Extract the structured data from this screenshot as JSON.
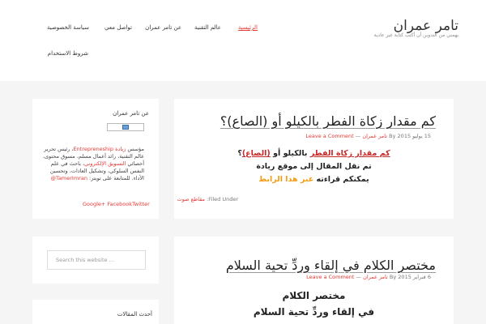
{
  "header": {
    "site_title": "تامر عمران",
    "site_description": "يهمني من التدوين أن أكتب كتابة غير عادية",
    "nav": [
      {
        "label": "الرئيسية",
        "active": true
      },
      {
        "label": "عالم التقنية"
      },
      {
        "label": "عن تامر عمران"
      },
      {
        "label": "تواصل معي"
      },
      {
        "label": "سياسة الخصوصية"
      },
      {
        "label": "شروط الاستخدام"
      }
    ]
  },
  "sidebar": {
    "about": {
      "title": "عن تامر عمران",
      "bio_1": "مؤسس",
      "bio_link": "زيادة Entrepreneship",
      "bio_2": "، رئيس تحرير",
      "bio_3": "عالم التقنية، رائد أعمال مسلم، مسوق محتوى،",
      "bio_4": "أخصائي",
      "bio_link2": "التسويق الإلكتروني",
      "bio_5": "، باحث في علم",
      "bio_6": "النفس السلوكي، وتشكيل العادات، وتحسين",
      "bio_7": "الأداء. للمتابعة على تويتر:",
      "bio_link3": "TamerImran@",
      "social": [
        "Google+",
        "Facebook",
        "Twitter"
      ]
    },
    "search": {
      "placeholder": "Search this website …"
    },
    "recent": {
      "title": "أحدث المقالات"
    }
  },
  "posts": [
    {
      "title": "كم مقدار زكاة الفطر بالكيلو أو (الصاع)؟",
      "day": "15",
      "month_year": "يوليو 2015",
      "by": "By",
      "author": "تامر عمران",
      "sep": "—",
      "comment": "Leave a Comment",
      "line1_a": "كم مقدار زكاة الفطر",
      "line1_b": "بالكيلو أو",
      "line1_c": "(الصاع)",
      "line1_d": "؟",
      "line2": "تم نقل المقال إلى موقع ريادة",
      "line3_a": "يمكنكم قراءته",
      "line3_b": "عبر هذا الرابط",
      "filed_label": "Filed Under:",
      "filed_cat": "مقاطع صوت"
    },
    {
      "title": "مختصر الكلام في إلقاء وردِّ تحية السلام",
      "day": "6",
      "month_year": "فبراير 2015",
      "by": "By",
      "author": "تامر عمران",
      "sep": "—",
      "comment": "Leave a Comment",
      "big1": "مختصر الكلام",
      "big2": "في إلقاء وردِّ تحية السلام"
    }
  ]
}
